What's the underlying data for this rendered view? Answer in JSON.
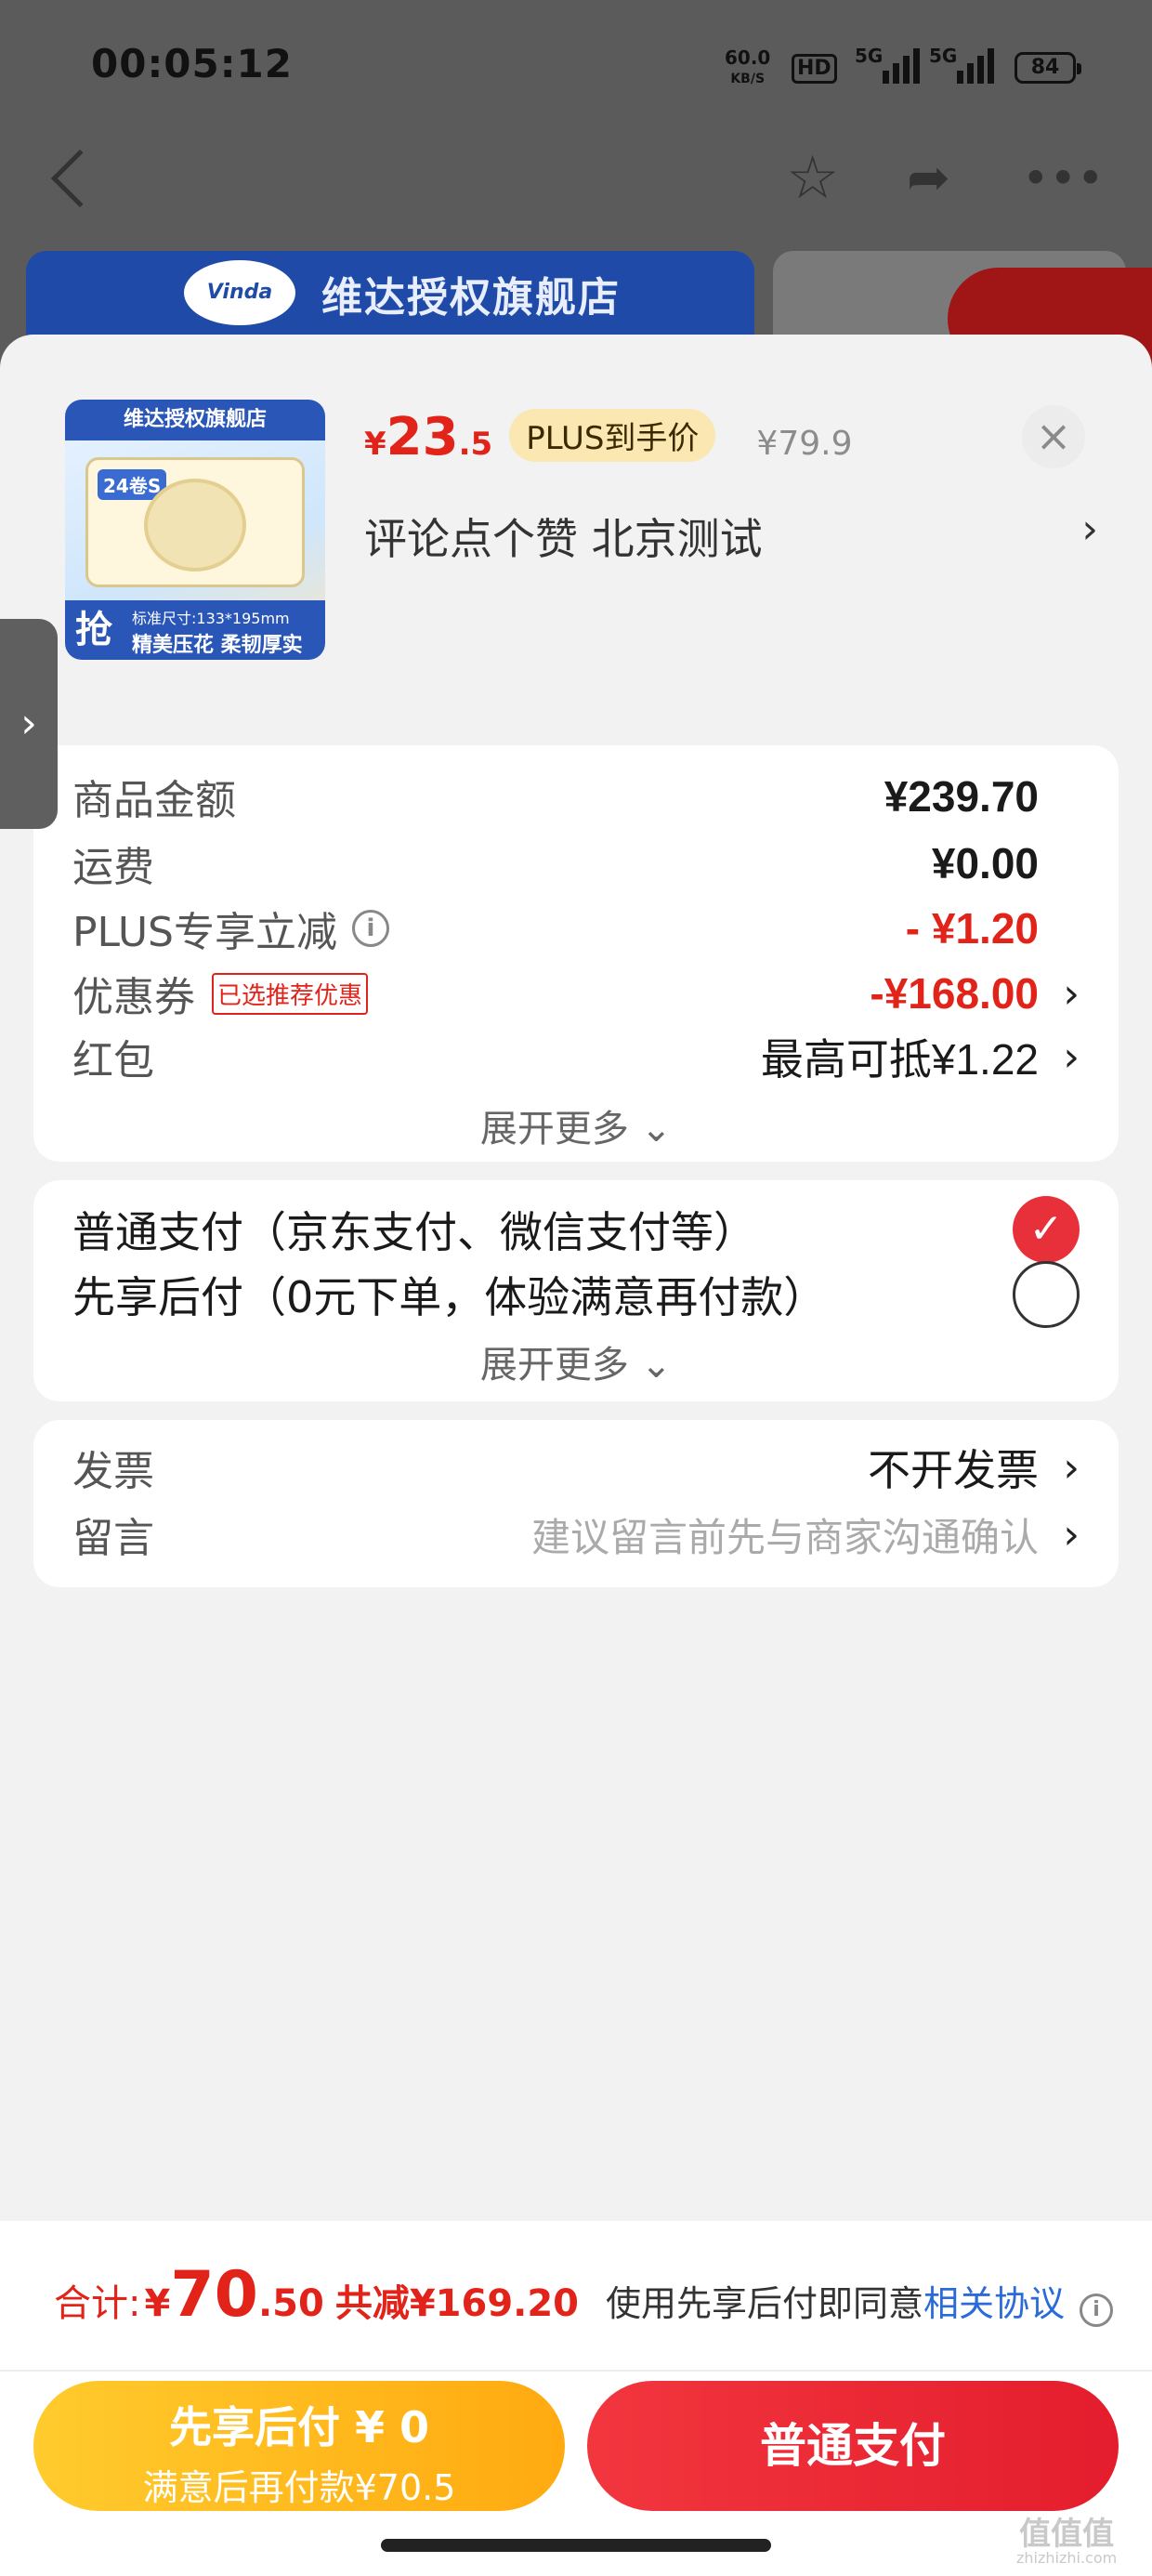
{
  "status_bar": {
    "time": "00:05:12",
    "net_speed": "60.0",
    "net_unit": "KB/S",
    "hd_label": "HD",
    "sig1_label": "5G",
    "sig2_label": "5G",
    "battery": "84"
  },
  "background": {
    "store_name": "维达授权旗舰店",
    "logo_text": "Vinda"
  },
  "product": {
    "image_top_text": "维达授权旗舰店",
    "image_count": "24卷S",
    "image_qiang": "抢",
    "image_spec": "标准尺寸:133*195mm",
    "image_slogan": "精美压花 柔韧厚实",
    "price_currency": "¥",
    "price_int": "23",
    "price_dec": ".5",
    "plus_badge": "PLUS到手价",
    "orig_price": "¥79.9",
    "spec": "评论点个赞  北京测试",
    "spec_arrow": "›",
    "close_label": "×"
  },
  "sidetab": {
    "arrow": "›"
  },
  "costs": {
    "goods_label": "商品金额",
    "goods_value": "¥239.70",
    "shipping_label": "运费",
    "shipping_value": "¥0.00",
    "plus_label": "PLUS专享立减",
    "plus_value": "- ¥1.20",
    "coupon_label": "优惠券",
    "coupon_tag": "已选推荐优惠",
    "coupon_value": "-¥168.00",
    "redpacket_label": "红包",
    "redpacket_value": "最高可抵¥1.22",
    "expand_label": "展开更多 ⌄",
    "chevron": "›",
    "info_icon": "i"
  },
  "payment": {
    "option1": "普通支付（京东支付、微信支付等）",
    "option2": "先享后付（0元下单，体验满意再付款）",
    "check_mark": "✓",
    "expand_label": "展开更多 ⌄"
  },
  "extras": {
    "invoice_label": "发票",
    "invoice_value": "不开发票",
    "message_label": "留言",
    "message_placeholder": "建议留言前先与商家沟通确认",
    "chevron": "›"
  },
  "footer": {
    "total_label": "合计:",
    "total_currency": "¥",
    "total_int": "70",
    "total_dec": ".50",
    "saving": "共减¥169.20",
    "agree_text": "使用先享后付即同意",
    "agree_link": "相关协议",
    "info_icon": "i",
    "btn_later_line1": "先享后付 ¥ 0",
    "btn_later_line2": "满意后再付款¥70.5",
    "btn_pay": "普通支付"
  },
  "watermark": {
    "main": "值值值",
    "sub": "zhizhizhi.com"
  },
  "colors": {
    "accent_red": "#e2231a",
    "plus_gold": "#fbe7b1",
    "later_yellow": "#ffb81c",
    "link_blue": "#2a6bd8"
  }
}
